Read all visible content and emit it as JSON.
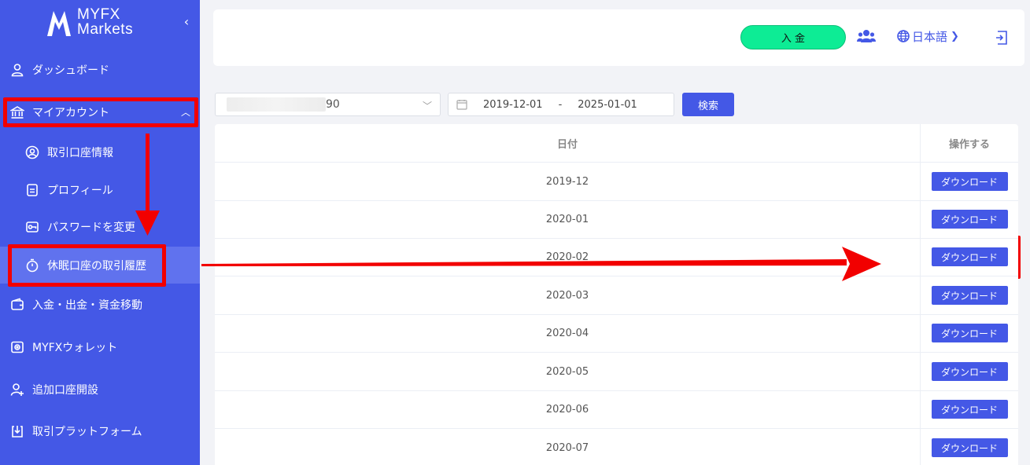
{
  "brand": {
    "line1": "MYFX",
    "line2": "Markets"
  },
  "sidebar": {
    "collapse_icon": "chevron-left-icon",
    "items": [
      {
        "label": "ダッシュボード",
        "icon": "user-icon"
      },
      {
        "label": "マイアカウント",
        "icon": "bank-icon"
      },
      {
        "label": "取引口座情報",
        "icon": "user-circle-icon"
      },
      {
        "label": "プロフィール",
        "icon": "document-icon"
      },
      {
        "label": "パスワードを変更",
        "icon": "key-icon"
      },
      {
        "label": "休眠口座の取引履歴",
        "icon": "stopwatch-icon"
      },
      {
        "label": "入金・出金・資金移動",
        "icon": "wallet-icon"
      },
      {
        "label": "MYFXウォレット",
        "icon": "safe-icon"
      },
      {
        "label": "追加口座開設",
        "icon": "user-add-icon"
      },
      {
        "label": "取引プラットフォーム",
        "icon": "download-icon"
      }
    ]
  },
  "header": {
    "deposit_label": "入 金",
    "language_label": "日本語"
  },
  "filters": {
    "account_suffix": "90",
    "date_start": "2019-12-01",
    "date_separator": "-",
    "date_end": "2025-01-01",
    "search_label": "検索"
  },
  "table": {
    "headers": {
      "date": "日付",
      "action": "操作する"
    },
    "download_label": "ダウンロード",
    "rows": [
      "2019-12",
      "2020-01",
      "2020-02",
      "2020-03",
      "2020-04",
      "2020-05",
      "2020-06",
      "2020-07"
    ]
  },
  "colors": {
    "sidebar": "#4458e6",
    "accent": "#4458e6",
    "deposit": "#0dec95",
    "highlight": "#f20000"
  }
}
